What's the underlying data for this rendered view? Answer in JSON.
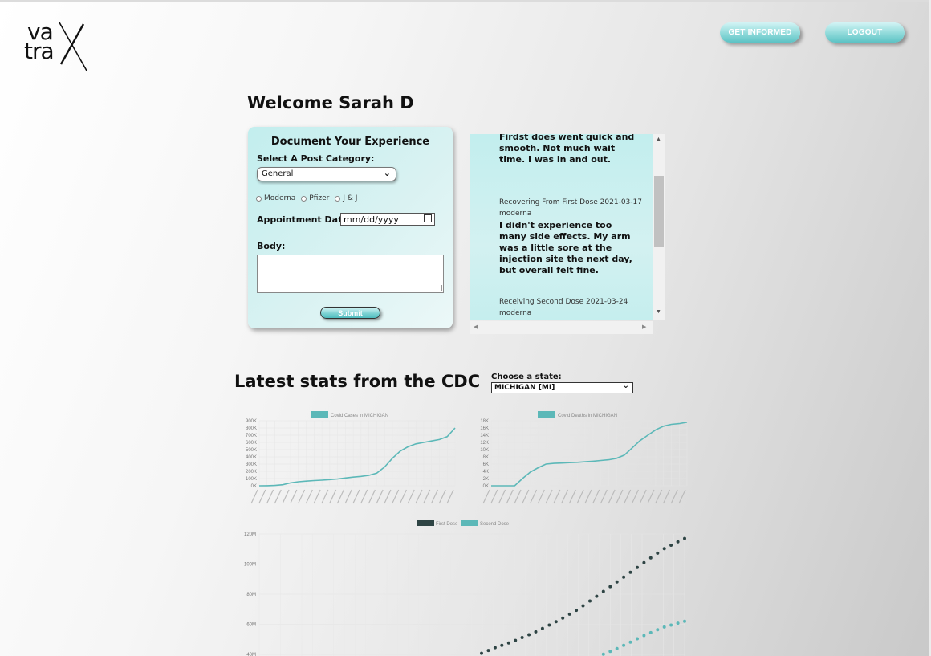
{
  "logo": {
    "line1": "va",
    "line2": "tra",
    "mark": "X"
  },
  "nav": {
    "get_informed": "GET INFORMED",
    "logout": "LOGOUT"
  },
  "welcome": "Welcome Sarah D",
  "form": {
    "title": "Document Your Experience",
    "category_label": "Select A Post Category:",
    "category_value": "General",
    "radios": [
      "Moderna",
      "Pfizer",
      "J & J"
    ],
    "date_label": "Appointment Date:",
    "date_placeholder": "mm/dd/yyyy",
    "body_label": "Body:",
    "submit": "Submit"
  },
  "posts": [
    {
      "meta": "",
      "vaccine": "",
      "body": "Firdst does went quick and smooth. Not much wait time. I was in and out."
    },
    {
      "meta": "Recovering From First Dose 2021-03-17",
      "vaccine": "moderna",
      "body": "I didn't experience too many side effects. My arm was a little sore at the injection site the next day, but overall felt fine."
    },
    {
      "meta": "Receiving Second Dose 2021-03-24",
      "vaccine": "moderna",
      "body": ""
    }
  ],
  "stats": {
    "heading": "Latest stats from the CDC",
    "state_label": "Choose a state:",
    "state_value": "MICHIGAN [MI]"
  },
  "colors": {
    "teal": "#5cb8b8",
    "dark": "#2e4444",
    "accent": "#8fdada"
  },
  "chart_data": [
    {
      "type": "line",
      "legend": "Covid Cases in MICHIGAN",
      "yticks": [
        "0K",
        "100K",
        "200K",
        "300K",
        "400K",
        "500K",
        "600K",
        "700K",
        "800K",
        "900K"
      ],
      "ylim": [
        0,
        900000
      ],
      "values": [
        0,
        1000,
        4000,
        15000,
        40000,
        55000,
        65000,
        72000,
        78000,
        85000,
        95000,
        108000,
        120000,
        130000,
        145000,
        175000,
        260000,
        380000,
        480000,
        540000,
        580000,
        600000,
        620000,
        640000,
        680000,
        800000
      ]
    },
    {
      "type": "line",
      "legend": "Covid Deaths in MICHIGAN",
      "yticks": [
        "0K",
        "2K",
        "4K",
        "6K",
        "8K",
        "10K",
        "12K",
        "14K",
        "16K",
        "18K"
      ],
      "ylim": [
        0,
        18000
      ],
      "values": [
        0,
        0,
        0,
        0,
        2000,
        3800,
        5000,
        6000,
        6200,
        6300,
        6400,
        6500,
        6650,
        6800,
        7000,
        7200,
        7600,
        8500,
        10500,
        12500,
        14000,
        15500,
        16500,
        17000,
        17200,
        17600
      ]
    },
    {
      "type": "scatter",
      "legend": [
        "First Dose",
        "Second Dose"
      ],
      "yticks": [
        "120M",
        "100M",
        "80M",
        "60M",
        "40M"
      ],
      "ylim": [
        40000000,
        120000000
      ],
      "series": [
        {
          "name": "First Dose",
          "values": [
            15000000,
            20000000,
            26000000,
            32000000,
            38000000,
            44000000,
            49000000,
            55000000,
            62000000,
            70000000,
            80000000,
            90000000,
            100000000,
            110000000,
            117000000
          ]
        },
        {
          "name": "Second Dose",
          "values": [
            5000000,
            8000000,
            11000000,
            14000000,
            17000000,
            20000000,
            23000000,
            26000000,
            30000000,
            34000000,
            39000000,
            45000000,
            52000000,
            58000000,
            62000000
          ]
        }
      ]
    }
  ]
}
